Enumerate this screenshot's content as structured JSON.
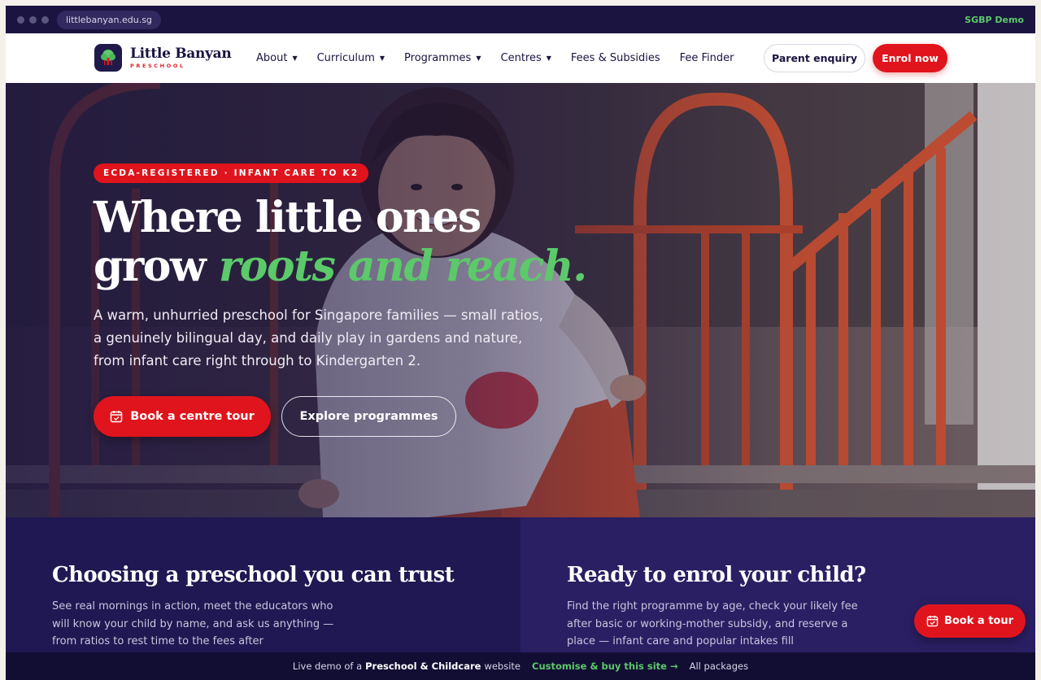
{
  "browser": {
    "url": "littlebanyan.edu.sg",
    "demo_tag": "SGBP Demo"
  },
  "brand": {
    "name": "Little Banyan",
    "tagline": "PRESCHOOL"
  },
  "nav": {
    "items": [
      {
        "label": "About",
        "has_dropdown": true
      },
      {
        "label": "Curriculum",
        "has_dropdown": true
      },
      {
        "label": "Programmes",
        "has_dropdown": true
      },
      {
        "label": "Centres",
        "has_dropdown": true
      },
      {
        "label": "Fees & Subsidies",
        "has_dropdown": false
      },
      {
        "label": "Fee Finder",
        "has_dropdown": false
      }
    ],
    "enquiry_label": "Parent enquiry",
    "enrol_label": "Enrol now"
  },
  "hero": {
    "badge": "ECDA-REGISTERED · INFANT CARE TO K2",
    "headline_line1": "Where little ones",
    "headline_line2_plain": "grow ",
    "headline_line2_accent": "roots and reach.",
    "body": "A warm, unhurried preschool for Singapore families — small ratios, a genuinely bilingual day, and daily play in gardens and nature, from infant care right through to Kindergarten 2.",
    "cta_primary": "Book a centre tour",
    "cta_secondary": "Explore programmes"
  },
  "panels": {
    "left": {
      "title": "Choosing a preschool you can trust",
      "text": "See real mornings in action, meet the educators who will know your child by name, and ask us anything — from ratios to rest time to the fees after"
    },
    "right": {
      "title": "Ready to enrol your child?",
      "text": "Find the right programme by age, check your likely fee after basic or working-mother subsidy, and reserve a place — infant care and popular intakes fill"
    }
  },
  "float_button": "Book a tour",
  "demo_bar": {
    "prefix": "Live demo of a",
    "product": "Preschool & Childcare",
    "suffix": "website",
    "customise": "Customise & buy this site →",
    "all_packages": "All packages"
  },
  "colors": {
    "navy": "#1b1440",
    "red": "#e0141c",
    "green": "#5cc96a"
  }
}
